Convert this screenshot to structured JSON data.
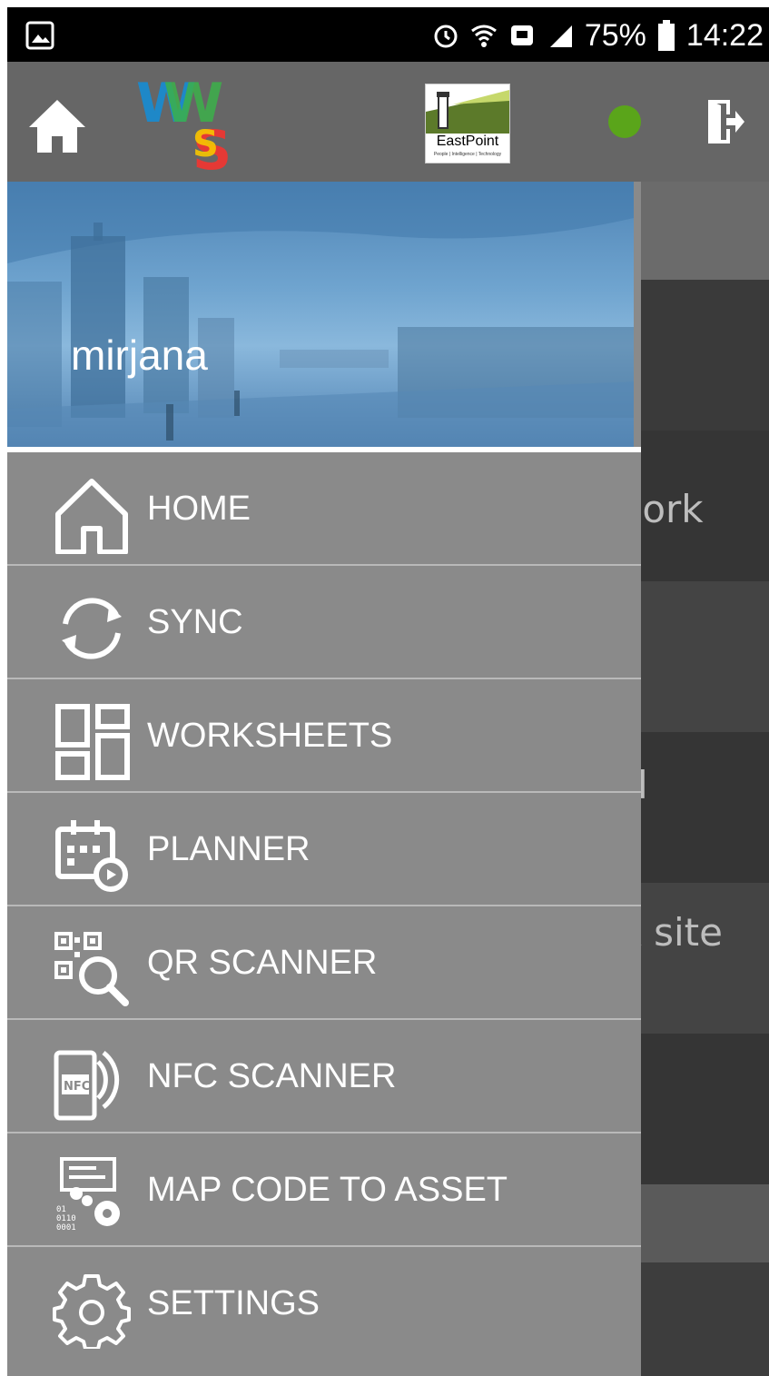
{
  "status_bar": {
    "battery": "75%",
    "time": "14:22",
    "icons": [
      "image-icon",
      "alarm-icon",
      "wifi-icon",
      "notification-icon",
      "signal-icon",
      "battery-icon"
    ]
  },
  "app_bar": {
    "logo_text": "EastPoint",
    "logo_tagline": "People | Intelligence | Technology",
    "status_color": "#5aa51a"
  },
  "drawer": {
    "username": "mirjana",
    "items": [
      {
        "label": "HOME",
        "icon": "home-outline-icon"
      },
      {
        "label": "SYNC",
        "icon": "sync-icon"
      },
      {
        "label": "WORKSHEETS",
        "icon": "worksheets-grid-icon"
      },
      {
        "label": "PLANNER",
        "icon": "calendar-planner-icon"
      },
      {
        "label": "QR SCANNER",
        "icon": "qr-scanner-icon"
      },
      {
        "label": "NFC SCANNER",
        "icon": "nfc-scanner-icon"
      },
      {
        "label": "MAP CODE TO ASSET",
        "icon": "map-code-icon"
      },
      {
        "label": "SETTINGS",
        "icon": "settings-gear-icon"
      }
    ]
  },
  "background_list": {
    "items": [
      "Cork",
      "l",
      "A site"
    ]
  }
}
